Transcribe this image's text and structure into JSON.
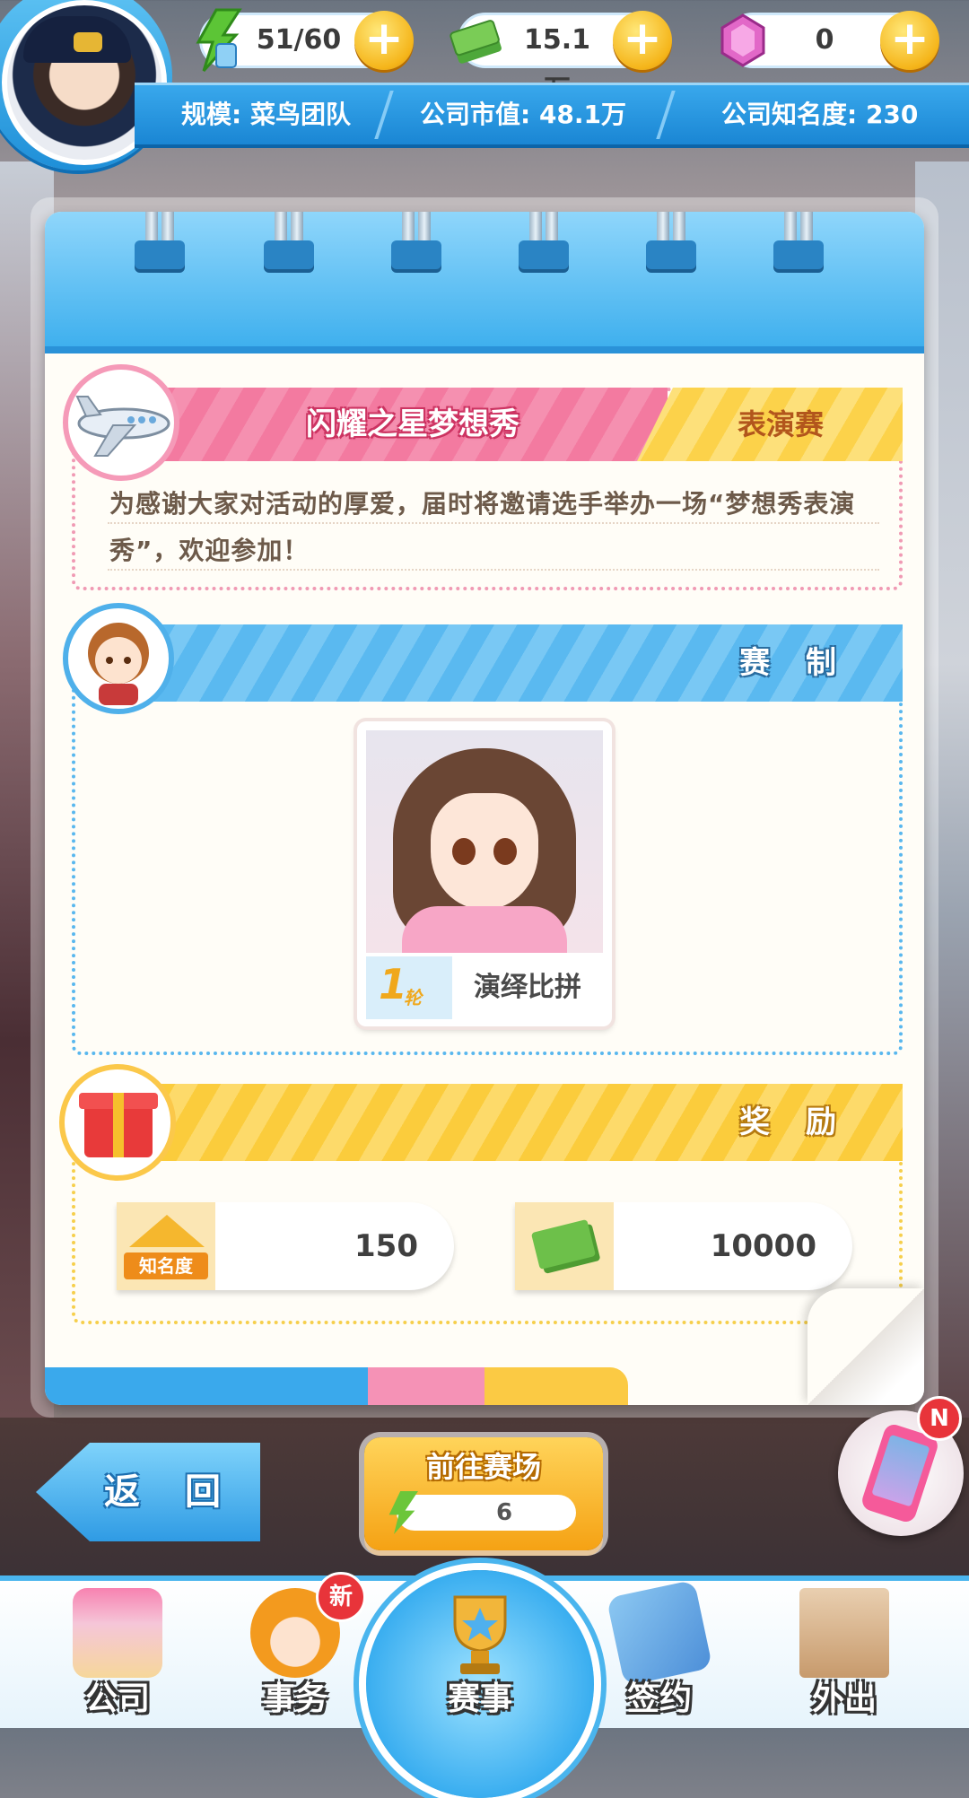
{
  "hud": {
    "energy": "51/60",
    "money": "15.1万",
    "gems": "0",
    "scale_label": "规模: 菜鸟团队",
    "market_value_label": "公司市值: 48.1万",
    "fame_label": "公司知名度: 230"
  },
  "event": {
    "title": "闪耀之星梦想秀",
    "type": "表演赛",
    "description": "为感谢大家对活动的厚爱，届时将邀请选手举办一场“梦想秀表演秀”，欢迎参加！"
  },
  "format": {
    "heading": "赛 制",
    "card": {
      "rank_number": "1",
      "rank_suffix": "轮",
      "label": "演绎比拼"
    }
  },
  "rewards": {
    "heading": "奖 励",
    "items": [
      {
        "icon": "fame-icon",
        "icon_label": "知名度",
        "value": "150"
      },
      {
        "icon": "cash-icon",
        "value": "10000"
      }
    ]
  },
  "buttons": {
    "back": "返 回",
    "go_arena": "前往赛场",
    "go_cost": "6",
    "phone_badge": "N"
  },
  "nav": {
    "items": [
      {
        "label": "公司",
        "icon": "building-icon"
      },
      {
        "label": "事务",
        "icon": "manager-icon",
        "badge": "新"
      },
      {
        "label": "赛事",
        "icon": "trophy-icon"
      },
      {
        "label": "签约",
        "icon": "contract-icon"
      },
      {
        "label": "外出",
        "icon": "door-icon"
      }
    ]
  },
  "colors": {
    "accent_blue": "#39a8ec",
    "pink": "#f37aa0",
    "gold": "#fbcc3c"
  }
}
